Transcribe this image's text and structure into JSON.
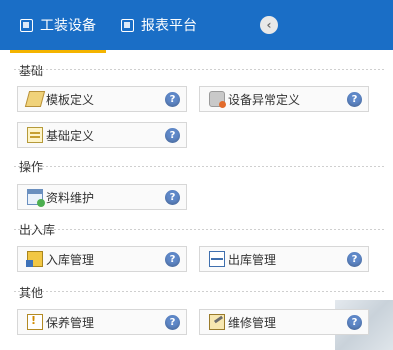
{
  "header": {
    "tabs": [
      {
        "label": "工装设备",
        "icon": "window-icon"
      },
      {
        "label": "报表平台",
        "icon": "window-icon"
      }
    ],
    "active_tab_color": "#f4b400",
    "bar_color": "#1a6ec6",
    "collapse_icon": "chevron-left-icon"
  },
  "sections": [
    {
      "title": "基础",
      "items": [
        {
          "label": "模板定义",
          "icon": "pencil-icon"
        },
        {
          "label": "设备异常定义",
          "icon": "gear-warning-icon"
        },
        {
          "label": "基础定义",
          "icon": "form-icon"
        }
      ]
    },
    {
      "title": "操作",
      "items": [
        {
          "label": "资料维护",
          "icon": "window-add-icon"
        }
      ]
    },
    {
      "title": "出入库",
      "items": [
        {
          "label": "入库管理",
          "icon": "stock-in-icon"
        },
        {
          "label": "出库管理",
          "icon": "stock-out-icon"
        }
      ]
    },
    {
      "title": "其他",
      "items": [
        {
          "label": "保养管理",
          "icon": "maintenance-warning-icon"
        },
        {
          "label": "维修管理",
          "icon": "repair-icon"
        }
      ]
    }
  ],
  "help_glyph": "?"
}
